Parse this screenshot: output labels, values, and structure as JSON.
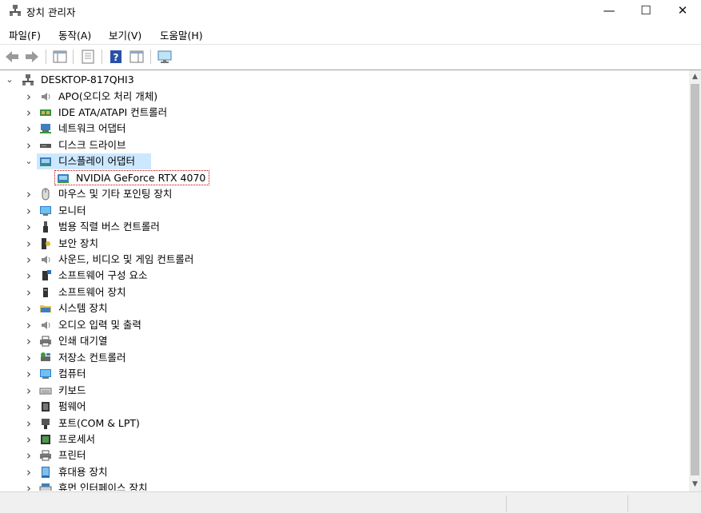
{
  "window": {
    "title": "장치 관리자",
    "minimize": "—",
    "maximize": "☐",
    "close": "✕"
  },
  "menu": {
    "items": [
      "파일(F)",
      "동작(A)",
      "보기(V)",
      "도움말(H)"
    ]
  },
  "toolbar": {
    "buttons": [
      "back-icon",
      "forward-icon",
      "show-hide-tree-icon",
      "properties-icon",
      "help-icon",
      "view-icon",
      "monitor-scan-icon"
    ]
  },
  "tree": {
    "root": "DESKTOP-817QHI3",
    "items": [
      {
        "label": "APO(오디오 처리 개체)",
        "icon": "speaker-icon",
        "expanded": false
      },
      {
        "label": "IDE ATA/ATAPI 컨트롤러",
        "icon": "ide-controller-icon",
        "expanded": false
      },
      {
        "label": "네트워크 어댑터",
        "icon": "network-adapter-icon",
        "expanded": false
      },
      {
        "label": "디스크 드라이브",
        "icon": "disk-drive-icon",
        "expanded": false
      },
      {
        "label": "디스플레이 어댑터",
        "icon": "display-adapter-icon",
        "expanded": true,
        "selected": true
      },
      {
        "label": "NVIDIA GeForce RTX 4070",
        "icon": "display-adapter-icon",
        "child": true,
        "focused": true
      },
      {
        "label": "마우스 및 기타 포인팅 장치",
        "icon": "mouse-icon",
        "expanded": false
      },
      {
        "label": "모니터",
        "icon": "monitor-icon",
        "expanded": false
      },
      {
        "label": "범용 직렬 버스 컨트롤러",
        "icon": "usb-icon",
        "expanded": false
      },
      {
        "label": "보안 장치",
        "icon": "security-key-icon",
        "expanded": false
      },
      {
        "label": "사운드, 비디오 및 게임 컨트롤러",
        "icon": "speaker-icon",
        "expanded": false
      },
      {
        "label": "소프트웨어 구성 요소",
        "icon": "software-component-icon",
        "expanded": false
      },
      {
        "label": "소프트웨어 장치",
        "icon": "software-device-icon",
        "expanded": false
      },
      {
        "label": "시스템 장치",
        "icon": "system-device-icon",
        "expanded": false
      },
      {
        "label": "오디오 입력 및 출력",
        "icon": "speaker-icon",
        "expanded": false
      },
      {
        "label": "인쇄 대기열",
        "icon": "printer-icon",
        "expanded": false
      },
      {
        "label": "저장소 컨트롤러",
        "icon": "storage-controller-icon",
        "expanded": false
      },
      {
        "label": "컴퓨터",
        "icon": "computer-icon",
        "expanded": false
      },
      {
        "label": "키보드",
        "icon": "keyboard-icon",
        "expanded": false
      },
      {
        "label": "펌웨어",
        "icon": "firmware-icon",
        "expanded": false
      },
      {
        "label": "포트(COM & LPT)",
        "icon": "port-icon",
        "expanded": false
      },
      {
        "label": "프로세서",
        "icon": "processor-icon",
        "expanded": false
      },
      {
        "label": "프린터",
        "icon": "printer-icon",
        "expanded": false
      },
      {
        "label": "휴대용 장치",
        "icon": "portable-device-icon",
        "expanded": false
      },
      {
        "label": "휴먼 인터페이스 장치",
        "icon": "hid-icon",
        "expanded": false
      }
    ]
  },
  "colors": {
    "selection": "#cce8ff",
    "focus_border": "#c00000",
    "status_bg": "#f0f0f0"
  }
}
